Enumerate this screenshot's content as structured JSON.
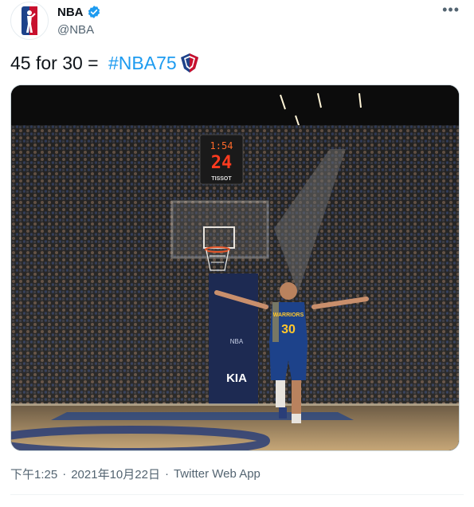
{
  "author": {
    "display_name": "NBA",
    "handle": "@NBA",
    "verified": true,
    "avatar_icon": "nba-logo-icon"
  },
  "tweet": {
    "text_prefix": "45 for 30 = ",
    "hashtag": "#NBA75",
    "hashtag_icon": "nba75-logo-icon"
  },
  "photo": {
    "shot_clock_time": "1:54",
    "shot_clock_seconds": "24",
    "shot_clock_sponsor": "TISSOT",
    "jersey_team": "WARRIORS",
    "jersey_number": "30",
    "sign_logo": "KIA"
  },
  "meta": {
    "time": "下午1:25",
    "separator": "·",
    "date": "2021年10月22日",
    "source": "Twitter Web App"
  },
  "colors": {
    "link": "#1d9bf0",
    "secondary_text": "#536471",
    "verified": "#1d9bf0",
    "jersey_blue": "#1d428a",
    "jersey_gold": "#ffc72c"
  }
}
